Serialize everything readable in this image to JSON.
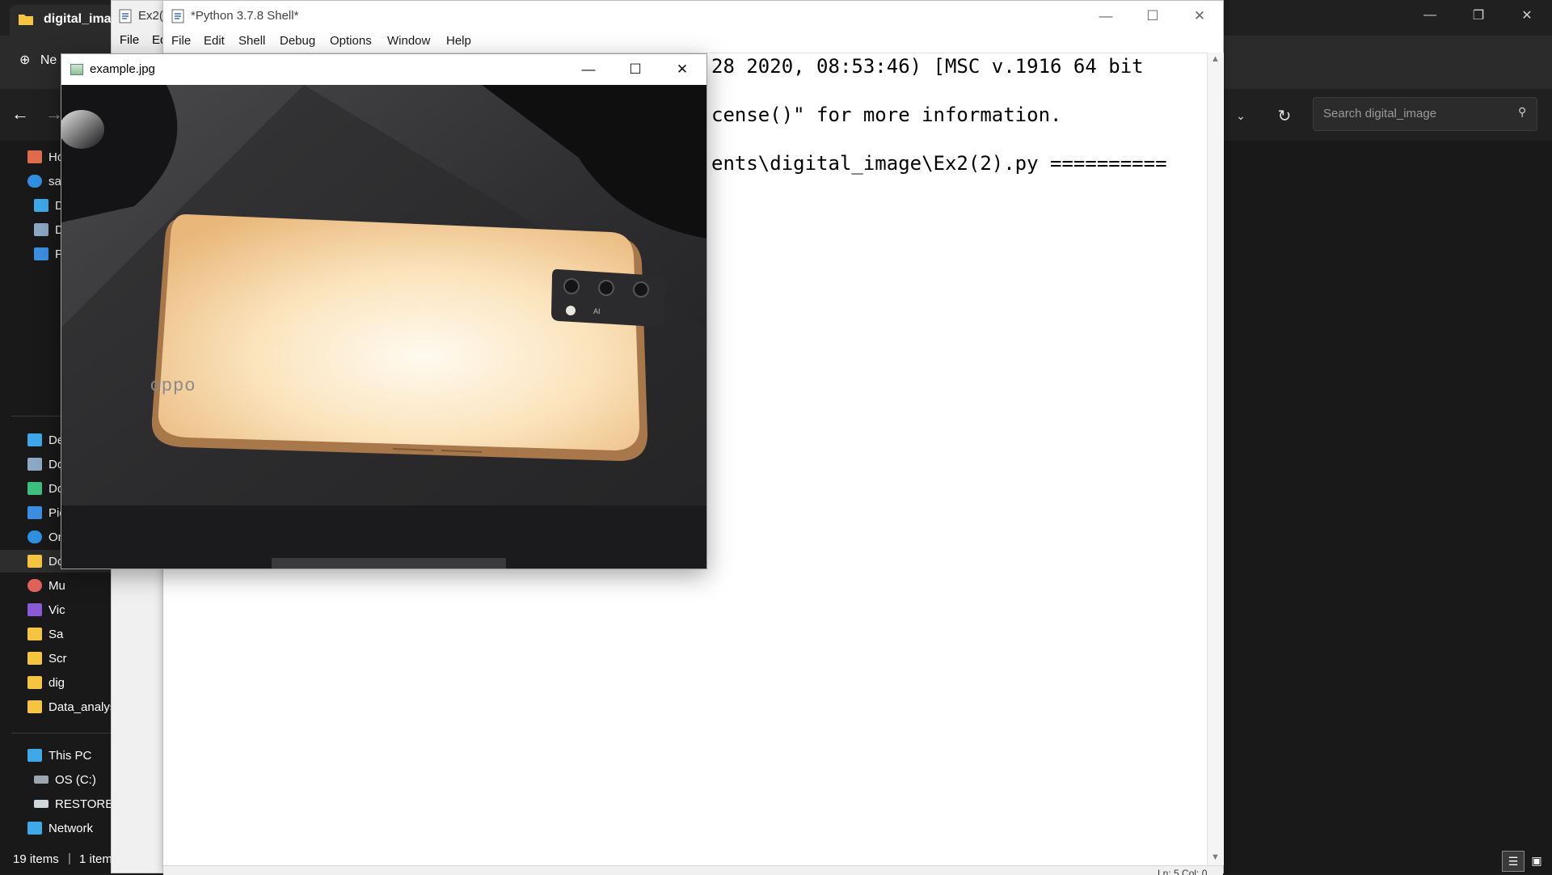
{
  "explorer": {
    "tab_title": "digital_ima",
    "new_label": "Ne",
    "search_placeholder": "Search digital_image",
    "nav": [
      {
        "label": "Ho"
      },
      {
        "label": "sa"
      },
      {
        "label": "D"
      },
      {
        "label": "D"
      },
      {
        "label": "P"
      },
      {
        "label": "De"
      },
      {
        "label": "Do"
      },
      {
        "label": "Do"
      },
      {
        "label": "Pic"
      },
      {
        "label": "On"
      },
      {
        "label": "Do"
      },
      {
        "label": "Mu"
      },
      {
        "label": "Vic"
      },
      {
        "label": "Sa"
      },
      {
        "label": "Scr"
      },
      {
        "label": "dig"
      },
      {
        "label": "Data_analys"
      },
      {
        "label": "This PC"
      },
      {
        "label": "OS (C:)"
      },
      {
        "label": "RESTORE ("
      },
      {
        "label": "Network"
      }
    ],
    "status": {
      "count": "19 items",
      "separator": "|",
      "selection": "1 item"
    }
  },
  "ex2_window": {
    "title": "Ex2(2",
    "menu_file": "File",
    "menu_edit": "Ed"
  },
  "shell": {
    "title": "*Python 3.7.8 Shell*",
    "menu": [
      "File",
      "Edit",
      "Shell",
      "Debug",
      "Options",
      "Window",
      "Help"
    ],
    "lines": [
      "28 2020, 08:53:46) [MSC v.1916 64 bit",
      "cense()\" for more information.",
      "ents\\digital_image\\Ex2(2).py =========="
    ],
    "status": "Ln: 5  Col: 0"
  },
  "image_window": {
    "title": "example.jpg",
    "phone_brand": "oppo",
    "camera_text": "AI"
  },
  "colors": {
    "explorer_bg": "#191919",
    "phone_body": "#f6d9a8",
    "desk": "#2e2e30"
  }
}
